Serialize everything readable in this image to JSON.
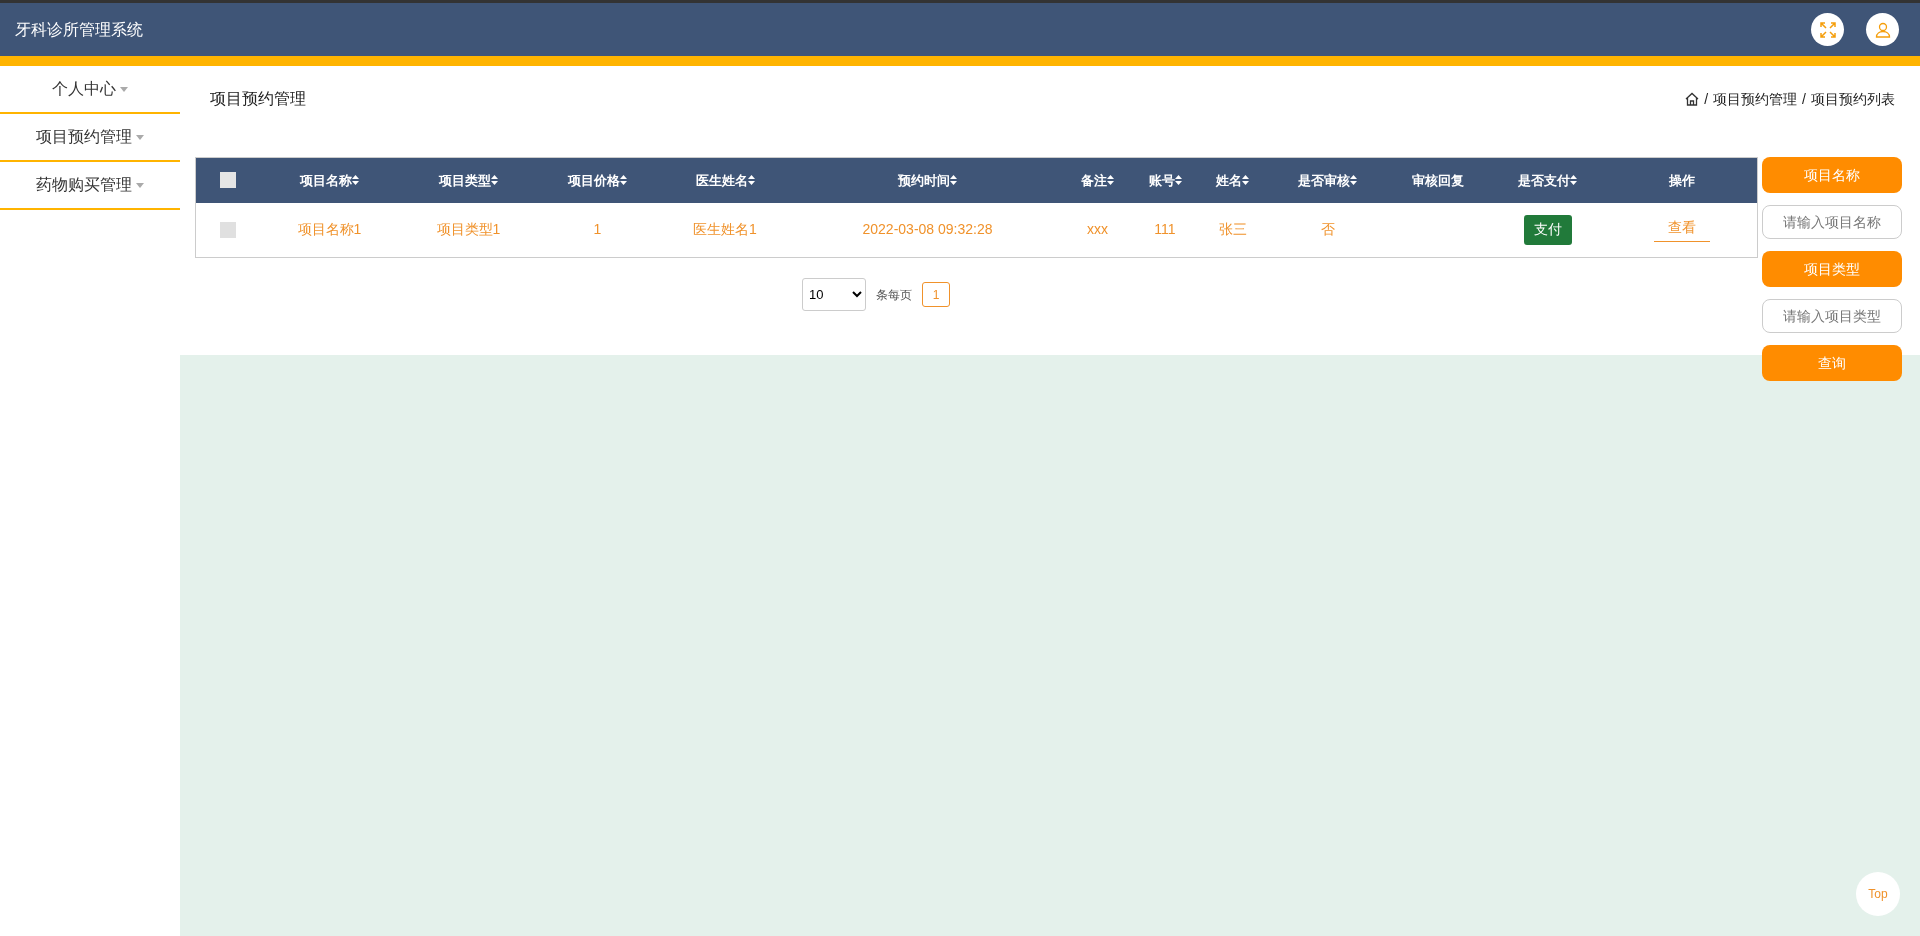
{
  "header": {
    "title": "牙科诊所管理系统"
  },
  "sidebar": {
    "items": [
      {
        "label": "个人中心",
        "expanded": false
      },
      {
        "label": "项目预约管理",
        "expanded": false
      },
      {
        "label": "药物购买管理",
        "expanded": false
      }
    ]
  },
  "page": {
    "title": "项目预约管理",
    "breadcrumb": [
      {
        "separator": "/",
        "label": "项目预约管理"
      },
      {
        "separator": "/",
        "label": "项目预约列表"
      }
    ]
  },
  "table": {
    "select_all": {
      "checked": false
    },
    "columns": [
      {
        "label": "项目名称",
        "sortable": true
      },
      {
        "label": "项目类型",
        "sortable": true
      },
      {
        "label": "项目价格",
        "sortable": true
      },
      {
        "label": "医生姓名",
        "sortable": true
      },
      {
        "label": "预约时间",
        "sortable": true
      },
      {
        "label": "备注",
        "sortable": true
      },
      {
        "label": "账号",
        "sortable": true
      },
      {
        "label": "姓名",
        "sortable": true
      },
      {
        "label": "是否审核",
        "sortable": true
      },
      {
        "label": "审核回复",
        "sortable": false
      },
      {
        "label": "是否支付",
        "sortable": true
      },
      {
        "label": "操作",
        "sortable": false
      }
    ],
    "rows": [
      {
        "checked": false,
        "cells": [
          "项目名称1",
          "项目类型1",
          "1",
          "医生姓名1",
          "2022-03-08 09:32:28",
          "xxx",
          "111",
          "张三",
          "否",
          ""
        ],
        "pay_button": "支付",
        "view_link": "查看"
      }
    ]
  },
  "pagination": {
    "page_size": "10",
    "per_page_label": "条每页",
    "pages": [
      {
        "label": "1",
        "selected": true
      }
    ]
  },
  "search": {
    "fields": [
      {
        "label": "项目名称",
        "placeholder": "请输入项目名称"
      },
      {
        "label": "项目类型",
        "placeholder": "请输入项目类型"
      }
    ],
    "button": "查询"
  },
  "top_button": "Top"
}
